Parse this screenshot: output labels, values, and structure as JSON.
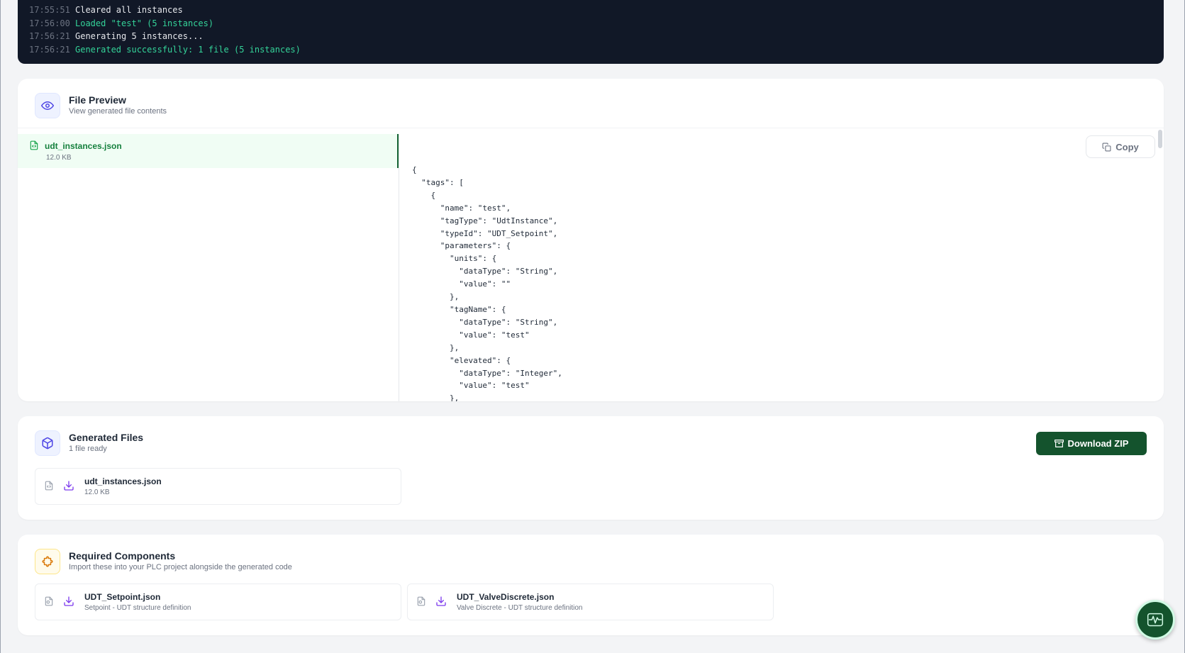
{
  "console": {
    "lines": [
      {
        "time": "17:55:51",
        "msg": "Cleared all instances",
        "kind": "normal"
      },
      {
        "time": "17:56:00",
        "msg": "Loaded \"test\" (5 instances)",
        "kind": "success"
      },
      {
        "time": "17:56:21",
        "msg": "Generating 5 instances...",
        "kind": "normal"
      },
      {
        "time": "17:56:21",
        "msg": "Generated successfully: 1 file (5 instances)",
        "kind": "success"
      }
    ]
  },
  "preview": {
    "title": "File Preview",
    "subtitle": "View generated file contents",
    "icon": "eye-icon",
    "files": [
      {
        "name": "udt_instances.json",
        "size": "12.0 KB"
      }
    ],
    "copy_label": "Copy",
    "code": "{\n  \"tags\": [\n    {\n      \"name\": \"test\",\n      \"tagType\": \"UdtInstance\",\n      \"typeId\": \"UDT_Setpoint\",\n      \"parameters\": {\n        \"units\": {\n          \"dataType\": \"String\",\n          \"value\": \"\"\n        },\n        \"tagName\": {\n          \"dataType\": \"String\",\n          \"value\": \"test\"\n        },\n        \"elevated\": {\n          \"dataType\": \"Integer\",\n          \"value\": \"test\"\n        },"
  },
  "generated": {
    "title": "Generated Files",
    "subtitle": "1 file ready",
    "icon": "package-icon",
    "download_label": "Download ZIP",
    "files": [
      {
        "name": "udt_instances.json",
        "size": "12.0 KB"
      }
    ]
  },
  "required": {
    "title": "Required Components",
    "subtitle": "Import these into your PLC project alongside the generated code",
    "icon": "puzzle-icon",
    "components": [
      {
        "name": "UDT_Setpoint.json",
        "desc": "Setpoint - UDT structure definition"
      },
      {
        "name": "UDT_ValveDiscrete.json",
        "desc": "Valve Discrete - UDT structure definition"
      }
    ]
  },
  "colors": {
    "accent_green": "#14532d",
    "success_text": "#34d399",
    "console_bg": "#111827",
    "icon_indigo": "#4f46e5",
    "icon_amber": "#d97706"
  }
}
